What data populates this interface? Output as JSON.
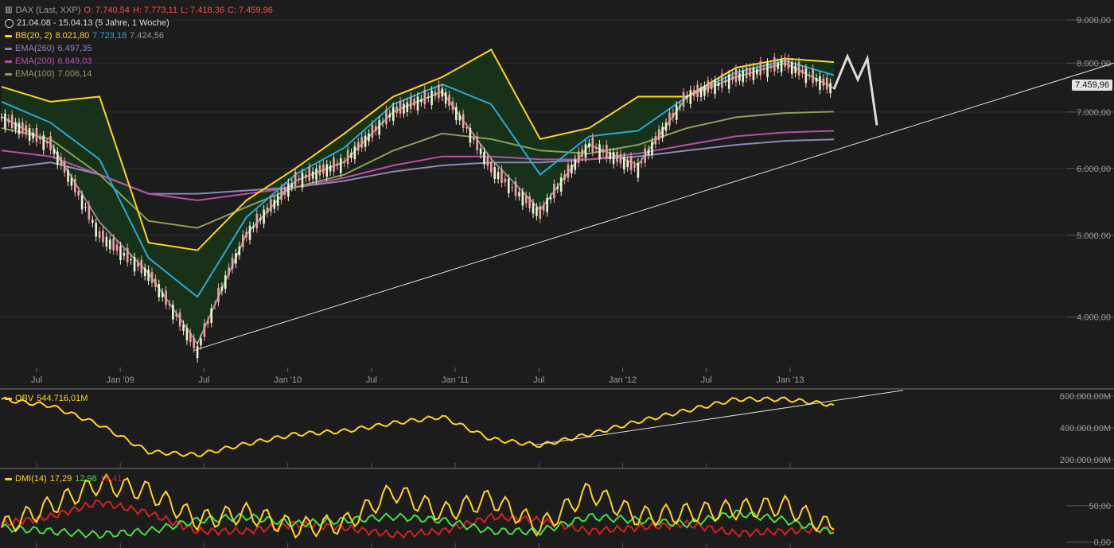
{
  "header": {
    "symbol": "DAX (Last, XXP)",
    "open": "O: 7.740,54",
    "high": "H: 7.773,11",
    "low": "L: 7.418,36",
    "close": "C: 7.459,96",
    "period": "21.04.08 - 15.04.13 (5 Jahre, 1 Woche)"
  },
  "indicators": [
    {
      "label": "BB(20, 2)",
      "values": [
        "8.021,80",
        "7.723,18",
        "7.424,56"
      ],
      "color": "#ffd21e"
    },
    {
      "label": "EMA(260)",
      "values": [
        "6.497,35"
      ],
      "color": "#8d86b8"
    },
    {
      "label": "EMA(200)",
      "values": [
        "6.649,03"
      ],
      "color": "#b84fa6"
    },
    {
      "label": "EMA(100)",
      "values": [
        "7.006,14"
      ],
      "color": "#87a05a"
    }
  ],
  "last_price": "7.459,96",
  "obv_legend": {
    "label": "OBV",
    "value": "544.716,01M"
  },
  "dmi_legend": {
    "label": "DMI(14)",
    "v1": "17,29",
    "v2": "12,98",
    "v3": "18,41"
  },
  "colors": {
    "background": "#1c1c1c",
    "bb_band": "#ffd21e",
    "bb_mid": "#2aa6d8",
    "bb_lower": "#8a8a8a",
    "bb_fill": "#18321a",
    "candle_up": "#e8f5d0",
    "candle_down": "#f0a0a0",
    "obv": "#ffd21e",
    "adx": "#ffd21e",
    "di_plus": "#44dd44",
    "di_minus": "#cc2222"
  },
  "chart_data": [
    {
      "type": "line",
      "title": "DAX (Last, XXP)",
      "x_ticks": [
        "Jul",
        "Jan '09",
        "Jul",
        "Jan '10",
        "Jul",
        "Jan '11",
        "Jul",
        "Jan '12",
        "Jul",
        "Jan '13"
      ],
      "y_ticks": [
        "4.000,00",
        "5.000,00",
        "6.000,00",
        "7.000,00",
        "8.000,00",
        "9.000,00"
      ],
      "y_scale": "log",
      "ylim": [
        3500,
        9300
      ],
      "series": [
        {
          "name": "DAX",
          "x": [
            "2008-04",
            "2008-07",
            "2008-10",
            "2009-01",
            "2009-03",
            "2009-07",
            "2010-01",
            "2010-07",
            "2011-01",
            "2011-05",
            "2011-08",
            "2011-09",
            "2012-01",
            "2012-06",
            "2012-09",
            "2013-01",
            "2013-03",
            "2013-04"
          ],
          "values": [
            6900,
            6400,
            5000,
            4500,
            3650,
            5000,
            5800,
            6100,
            7000,
            7400,
            6000,
            5300,
            6400,
            6000,
            7300,
            7700,
            8000,
            7460
          ]
        },
        {
          "name": "BB(20, 2)",
          "values": [
            7500,
            7200,
            7300,
            4900,
            4800,
            5500,
            6000,
            6600,
            7300,
            7700,
            8300,
            6500,
            6700,
            7300,
            7300,
            7900,
            8100,
            8022
          ]
        },
        {
          "name": "EMA(260)",
          "values": [
            6000,
            6100,
            5900,
            5600,
            5600,
            5650,
            5700,
            5800,
            5950,
            6050,
            6100,
            6100,
            6150,
            6200,
            6300,
            6400,
            6470,
            6497
          ]
        },
        {
          "name": "EMA(200)",
          "values": [
            6300,
            6200,
            5900,
            5600,
            5500,
            5600,
            5700,
            5850,
            6050,
            6200,
            6200,
            6150,
            6150,
            6250,
            6400,
            6550,
            6620,
            6649
          ]
        },
        {
          "name": "EMA(100)",
          "values": [
            6700,
            6500,
            5900,
            5200,
            5100,
            5400,
            5700,
            5900,
            6300,
            6600,
            6500,
            6300,
            6250,
            6400,
            6700,
            6900,
            6980,
            7006
          ]
        }
      ]
    },
    {
      "type": "line",
      "series": [
        {
          "name": "OBV",
          "values": [
            580,
            540,
            420,
            250,
            230,
            300,
            360,
            380,
            430,
            470,
            330,
            290,
            360,
            440,
            510,
            580,
            580,
            545
          ]
        }
      ],
      "y_ticks": [
        "200.000,00M",
        "400.000,00M",
        "600.000,00M"
      ],
      "ylim": [
        150,
        640
      ]
    },
    {
      "type": "line",
      "series": [
        {
          "name": "DMI(14)",
          "values": [
            20,
            50,
            80,
            70,
            30,
            40,
            20,
            25,
            70,
            40,
            60,
            20,
            70,
            35,
            40,
            45,
            50,
            17.29
          ]
        },
        {
          "name": "+DI",
          "values": [
            20,
            15,
            10,
            15,
            30,
            35,
            25,
            30,
            35,
            30,
            15,
            15,
            35,
            30,
            25,
            40,
            30,
            12.98
          ]
        },
        {
          "name": "-DI",
          "values": [
            25,
            35,
            55,
            40,
            15,
            15,
            25,
            20,
            10,
            15,
            35,
            30,
            15,
            20,
            25,
            12,
            15,
            18.41
          ]
        }
      ],
      "y_ticks": [
        "0,00",
        "50,00"
      ],
      "ylim": [
        -8,
        100
      ]
    }
  ]
}
